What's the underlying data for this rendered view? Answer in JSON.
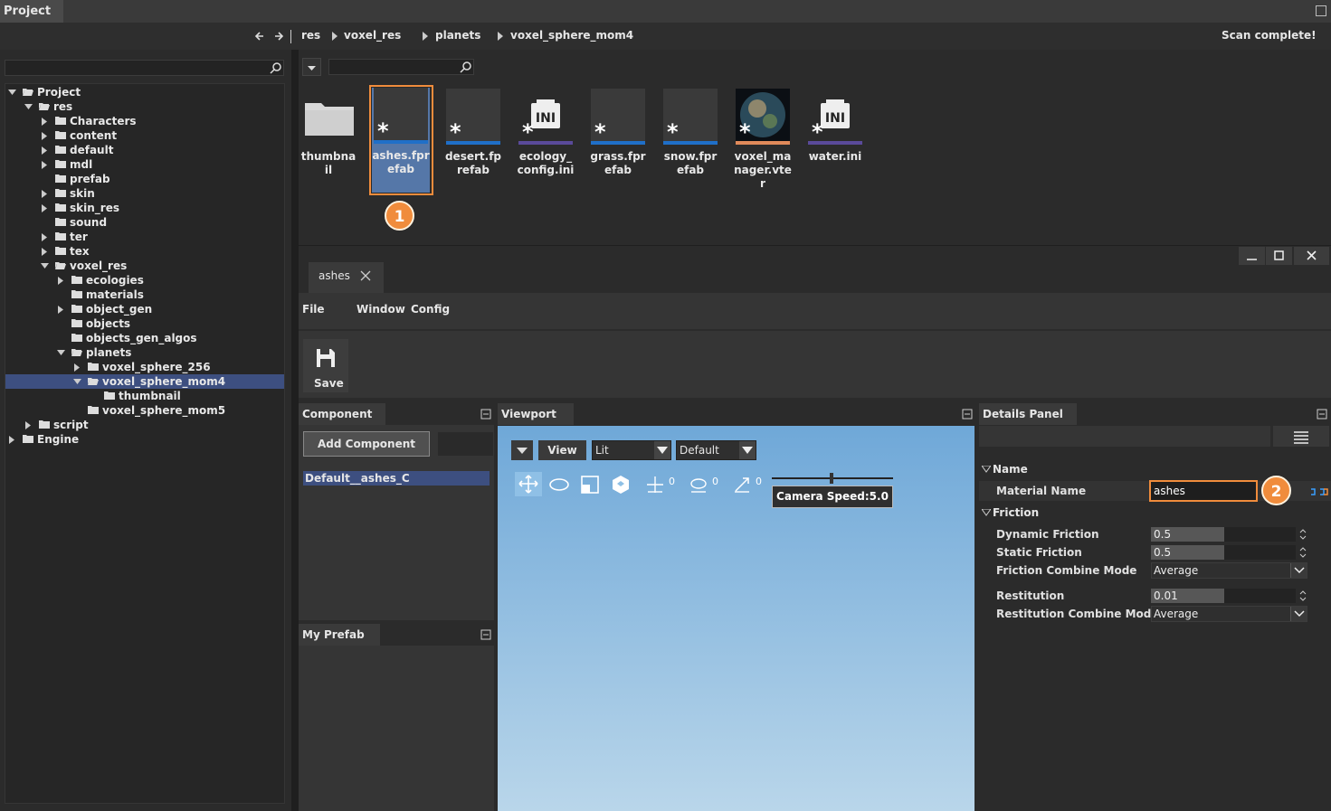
{
  "project_panel": {
    "title": "Project"
  },
  "breadcrumb": {
    "items": [
      "res",
      "voxel_res",
      "planets",
      "voxel_sphere_mom4"
    ]
  },
  "status": "Scan complete!",
  "tree": [
    {
      "label": "Project",
      "depth": 0,
      "arrow": "down",
      "open": true
    },
    {
      "label": "res",
      "depth": 1,
      "arrow": "down",
      "open": true
    },
    {
      "label": "Characters",
      "depth": 2,
      "arrow": "right"
    },
    {
      "label": "content",
      "depth": 2,
      "arrow": "right"
    },
    {
      "label": "default",
      "depth": 2,
      "arrow": "right"
    },
    {
      "label": "mdl",
      "depth": 2,
      "arrow": "right"
    },
    {
      "label": "prefab",
      "depth": 2,
      "arrow": "none"
    },
    {
      "label": "skin",
      "depth": 2,
      "arrow": "right"
    },
    {
      "label": "skin_res",
      "depth": 2,
      "arrow": "right"
    },
    {
      "label": "sound",
      "depth": 2,
      "arrow": "none"
    },
    {
      "label": "ter",
      "depth": 2,
      "arrow": "right"
    },
    {
      "label": "tex",
      "depth": 2,
      "arrow": "right"
    },
    {
      "label": "voxel_res",
      "depth": 2,
      "arrow": "down",
      "open": true
    },
    {
      "label": "ecologies",
      "depth": 3,
      "arrow": "right"
    },
    {
      "label": "materials",
      "depth": 3,
      "arrow": "none"
    },
    {
      "label": "object_gen",
      "depth": 3,
      "arrow": "right"
    },
    {
      "label": "objects",
      "depth": 3,
      "arrow": "none"
    },
    {
      "label": "objects_gen_algos",
      "depth": 3,
      "arrow": "none"
    },
    {
      "label": "planets",
      "depth": 3,
      "arrow": "down",
      "open": true
    },
    {
      "label": "voxel_sphere_256",
      "depth": 4,
      "arrow": "right"
    },
    {
      "label": "voxel_sphere_mom4",
      "depth": 4,
      "arrow": "down",
      "open": true,
      "selected": true
    },
    {
      "label": "thumbnail",
      "depth": 5,
      "arrow": "none"
    },
    {
      "label": "voxel_sphere_mom5",
      "depth": 4,
      "arrow": "none"
    },
    {
      "label": "script",
      "depth": 1,
      "arrow": "right"
    },
    {
      "label": "Engine",
      "depth": 0,
      "arrow": "right"
    }
  ],
  "assets": [
    {
      "name": "thumbnail",
      "kind": "folder",
      "bar": "none"
    },
    {
      "name": "ashes.fprefab",
      "kind": "prefab",
      "bar": "#1f6fc8",
      "selected": true
    },
    {
      "name": "desert.fprefab",
      "kind": "prefab",
      "bar": "#1f6fc8"
    },
    {
      "name": "ecology_config.ini",
      "kind": "ini",
      "bar": "#5a4a9a"
    },
    {
      "name": "grass.fprefab",
      "kind": "prefab",
      "bar": "#1f6fc8"
    },
    {
      "name": "snow.fprefab",
      "kind": "prefab",
      "bar": "#1f6fc8"
    },
    {
      "name": "voxel_manager.vter",
      "kind": "planet",
      "bar": "#e08a5a"
    },
    {
      "name": "water.ini",
      "kind": "ini",
      "bar": "#5a4a9a"
    }
  ],
  "callouts": [
    "1",
    "2"
  ],
  "editor": {
    "tab": "ashes",
    "menu": [
      "File",
      "Window",
      "Config"
    ],
    "save_label": "Save"
  },
  "component_panel": {
    "title": "Component",
    "add_button": "Add Component",
    "items": [
      "Default__ashes_C"
    ]
  },
  "prefab_panel": {
    "title": "My Prefab"
  },
  "viewport": {
    "title": "Viewport",
    "view_button": "View",
    "mode": "Lit",
    "preset": "Default",
    "counts": [
      "0",
      "0",
      "0"
    ],
    "camera_speed": "Camera Speed:5.0"
  },
  "details": {
    "title": "Details Panel",
    "sections": {
      "name": "Name",
      "friction": "Friction"
    },
    "material_name_label": "Material Name",
    "material_name_value": "ashes",
    "dynamic_friction_label": "Dynamic Friction",
    "dynamic_friction_value": "0.5",
    "static_friction_label": "Static Friction",
    "static_friction_value": "0.5",
    "friction_combine_label": "Friction Combine Mode",
    "friction_combine_value": "Average",
    "restitution_label": "Restitution",
    "restitution_value": "0.01",
    "restitution_combine_label": "Restitution Combine Mode",
    "restitution_combine_value": "Average"
  },
  "colors": {
    "accent": "#f08c3c",
    "selection": "#3d4f80",
    "viewport_sky_top": "#6fa8d8",
    "viewport_sky_bottom": "#b9d6ea"
  }
}
